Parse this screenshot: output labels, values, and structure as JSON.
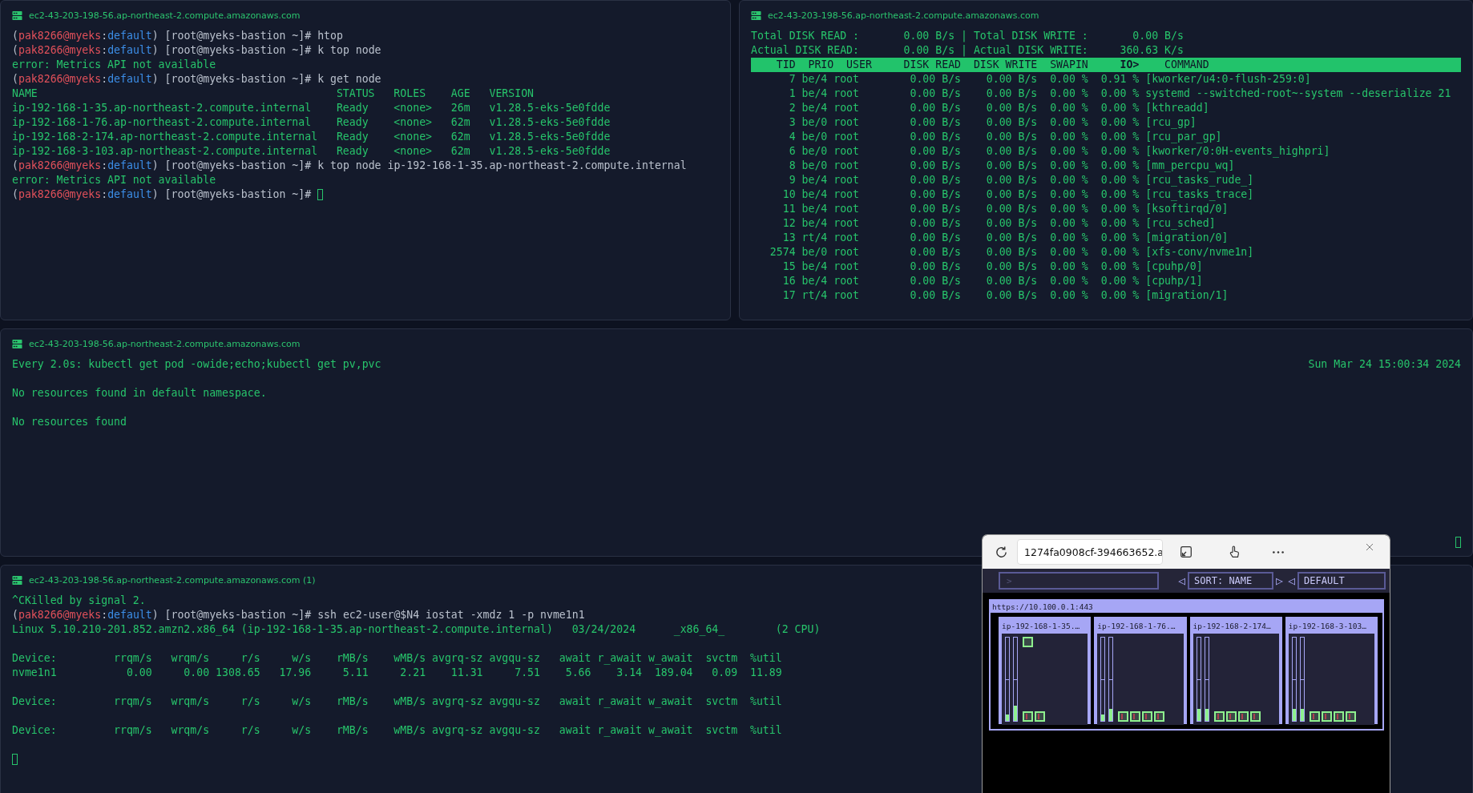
{
  "panes": [
    {
      "title": "ec2-43-203-198-56.ap-northeast-2.compute.amazonaws.com",
      "lines": [
        {
          "kind": "prompt",
          "cursor": false,
          "parts": [
            {
              "kind": "plain",
              "text": "("
            },
            {
              "kind": "user",
              "text": "pak8266@myeks"
            },
            {
              "kind": "plain",
              "text": ":"
            },
            {
              "kind": "context",
              "text": "default"
            },
            {
              "kind": "plain",
              "text": ") [root@myeks-bastion ~]# htop"
            }
          ]
        },
        {
          "kind": "prompt",
          "cursor": false,
          "parts": [
            {
              "kind": "plain",
              "text": "("
            },
            {
              "kind": "user",
              "text": "pak8266@myeks"
            },
            {
              "kind": "plain",
              "text": ":"
            },
            {
              "kind": "context",
              "text": "default"
            },
            {
              "kind": "plain",
              "text": ") [root@myeks-bastion ~]# k top node"
            }
          ]
        },
        {
          "kind": "output",
          "text": "error: Metrics API not available"
        },
        {
          "kind": "prompt",
          "cursor": false,
          "parts": [
            {
              "kind": "plain",
              "text": "("
            },
            {
              "kind": "user",
              "text": "pak8266@myeks"
            },
            {
              "kind": "plain",
              "text": ":"
            },
            {
              "kind": "context",
              "text": "default"
            },
            {
              "kind": "plain",
              "text": ") [root@myeks-bastion ~]# k get node"
            }
          ]
        },
        {
          "kind": "output",
          "text": "NAME                                               STATUS   ROLES    AGE   VERSION"
        },
        {
          "kind": "output",
          "text": "ip-192-168-1-35.ap-northeast-2.compute.internal    Ready    <none>   26m   v1.28.5-eks-5e0fdde"
        },
        {
          "kind": "output",
          "text": "ip-192-168-1-76.ap-northeast-2.compute.internal    Ready    <none>   62m   v1.28.5-eks-5e0fdde"
        },
        {
          "kind": "output",
          "text": "ip-192-168-2-174.ap-northeast-2.compute.internal   Ready    <none>   62m   v1.28.5-eks-5e0fdde"
        },
        {
          "kind": "output",
          "text": "ip-192-168-3-103.ap-northeast-2.compute.internal   Ready    <none>   62m   v1.28.5-eks-5e0fdde"
        },
        {
          "kind": "prompt",
          "cursor": false,
          "parts": [
            {
              "kind": "plain",
              "text": "("
            },
            {
              "kind": "user",
              "text": "pak8266@myeks"
            },
            {
              "kind": "plain",
              "text": ":"
            },
            {
              "kind": "context",
              "text": "default"
            },
            {
              "kind": "plain",
              "text": ") [root@myeks-bastion ~]# k top node ip-192-168-1-35.ap-northeast-2.compute.internal"
            }
          ]
        },
        {
          "kind": "output",
          "text": "error: Metrics API not available"
        },
        {
          "kind": "prompt",
          "cursor": true,
          "parts": [
            {
              "kind": "plain",
              "text": "("
            },
            {
              "kind": "user",
              "text": "pak8266@myeks"
            },
            {
              "kind": "plain",
              "text": ":"
            },
            {
              "kind": "context",
              "text": "default"
            },
            {
              "kind": "plain",
              "text": ") [root@myeks-bastion ~]#"
            }
          ]
        }
      ]
    },
    {
      "title": "ec2-43-203-198-56.ap-northeast-2.compute.amazonaws.com",
      "lines": [
        {
          "kind": "output",
          "text": "Total DISK READ :       0.00 B/s | Total DISK WRITE :       0.00 B/s"
        },
        {
          "kind": "output",
          "text": "Actual DISK READ:       0.00 B/s | Actual DISK WRITE:     360.63 K/s"
        },
        {
          "kind": "header",
          "text": "    TID  PRIO  USER     DISK READ  DISK WRITE  SWAPIN     **IO>**    COMMAND"
        },
        {
          "kind": "output",
          "text": "      7 be/4 root        0.00 B/s    0.00 B/s  0.00 %  0.91 % [kworker/u4:0-flush-259:0]"
        },
        {
          "kind": "output",
          "text": "      1 be/4 root        0.00 B/s    0.00 B/s  0.00 %  0.00 % systemd --switched-root~-system --deserialize 21"
        },
        {
          "kind": "output",
          "text": "      2 be/4 root        0.00 B/s    0.00 B/s  0.00 %  0.00 % [kthreadd]"
        },
        {
          "kind": "output",
          "text": "      3 be/0 root        0.00 B/s    0.00 B/s  0.00 %  0.00 % [rcu_gp]"
        },
        {
          "kind": "output",
          "text": "      4 be/0 root        0.00 B/s    0.00 B/s  0.00 %  0.00 % [rcu_par_gp]"
        },
        {
          "kind": "output",
          "text": "      6 be/0 root        0.00 B/s    0.00 B/s  0.00 %  0.00 % [kworker/0:0H-events_highpri]"
        },
        {
          "kind": "output",
          "text": "      8 be/0 root        0.00 B/s    0.00 B/s  0.00 %  0.00 % [mm_percpu_wq]"
        },
        {
          "kind": "output",
          "text": "      9 be/4 root        0.00 B/s    0.00 B/s  0.00 %  0.00 % [rcu_tasks_rude_]"
        },
        {
          "kind": "output",
          "text": "     10 be/4 root        0.00 B/s    0.00 B/s  0.00 %  0.00 % [rcu_tasks_trace]"
        },
        {
          "kind": "output",
          "text": "     11 be/4 root        0.00 B/s    0.00 B/s  0.00 %  0.00 % [ksoftirqd/0]"
        },
        {
          "kind": "output",
          "text": "     12 be/4 root        0.00 B/s    0.00 B/s  0.00 %  0.00 % [rcu_sched]"
        },
        {
          "kind": "output",
          "text": "     13 rt/4 root        0.00 B/s    0.00 B/s  0.00 %  0.00 % [migration/0]"
        },
        {
          "kind": "output",
          "text": "   2574 be/0 root        0.00 B/s    0.00 B/s  0.00 %  0.00 % [xfs-conv/nvme1n]"
        },
        {
          "kind": "output",
          "text": "     15 be/4 root        0.00 B/s    0.00 B/s  0.00 %  0.00 % [cpuhp/0]"
        },
        {
          "kind": "output",
          "text": "     16 be/4 root        0.00 B/s    0.00 B/s  0.00 %  0.00 % [cpuhp/1]"
        },
        {
          "kind": "output",
          "text": "     17 rt/4 root        0.00 B/s    0.00 B/s  0.00 %  0.00 % [migration/1]"
        }
      ]
    },
    {
      "title": "ec2-43-203-198-56.ap-northeast-2.compute.amazonaws.com",
      "lines": [
        {
          "kind": "watch",
          "text": "Every 2.0s: kubectl get pod -owide;echo;kubectl get pv,pvc",
          "time": "Sun Mar 24 15:00:34 2024"
        },
        {
          "kind": "blank"
        },
        {
          "kind": "output",
          "text": "No resources found in default namespace."
        },
        {
          "kind": "blank"
        },
        {
          "kind": "output",
          "text": "No resources found"
        },
        {
          "kind": "end_cursor"
        }
      ]
    },
    {
      "title": "ec2-43-203-198-56.ap-northeast-2.compute.amazonaws.com (1)",
      "lines": [
        {
          "kind": "output",
          "text": "^CKilled by signal 2."
        },
        {
          "kind": "prompt",
          "cursor": false,
          "parts": [
            {
              "kind": "plain",
              "text": "("
            },
            {
              "kind": "user",
              "text": "pak8266@myeks"
            },
            {
              "kind": "plain",
              "text": ":"
            },
            {
              "kind": "context",
              "text": "default"
            },
            {
              "kind": "plain",
              "text": ") [root@myeks-bastion ~]# ssh ec2-user@$N4 iostat -xmdz 1 -p nvme1n1"
            }
          ]
        },
        {
          "kind": "output",
          "text": "Linux 5.10.210-201.852.amzn2.x86_64 (ip-192-168-1-35.ap-northeast-2.compute.internal)   03/24/2024      _x86_64_        (2 CPU)"
        },
        {
          "kind": "blank"
        },
        {
          "kind": "output",
          "text": "Device:         rrqm/s   wrqm/s     r/s     w/s    rMB/s    wMB/s avgrq-sz avgqu-sz   await r_await w_await  svctm  %util"
        },
        {
          "kind": "output",
          "text": "nvme1n1           0.00     0.00 1308.65   17.96     5.11     2.21    11.31     7.51    5.66    3.14  189.04   0.09  11.89"
        },
        {
          "kind": "blank"
        },
        {
          "kind": "output",
          "text": "Device:         rrqm/s   wrqm/s     r/s     w/s    rMB/s    wMB/s avgrq-sz avgqu-sz   await r_await w_await  svctm  %util"
        },
        {
          "kind": "blank"
        },
        {
          "kind": "output",
          "text": "Device:         rrqm/s   wrqm/s     r/s     w/s    rMB/s    wMB/s avgrq-sz avgqu-sz   await r_await w_await  svctm  %util"
        },
        {
          "kind": "blank"
        },
        {
          "kind": "cursor"
        }
      ]
    }
  ],
  "viewer": {
    "address": "1274fa0908cf-394663652.a",
    "filter": {
      "placeholder": ">"
    },
    "sort_prev": "◁",
    "sort": "SORT: NAME",
    "sort_next": "▷",
    "view_prev": "◁",
    "view": "DEFAULT",
    "cluster": {
      "url": "https://10.100.0.1:443",
      "nodes": [
        {
          "name": "ip-192-168-1-35.…",
          "bars": [
            {
              "level": 0.08
            },
            {
              "level": 0.18
            }
          ],
          "pods": [
            {
              "kind": "pending"
            },
            {
              "kind": "running"
            },
            {
              "kind": "running"
            }
          ]
        },
        {
          "name": "ip-192-168-1-76.…",
          "bars": [
            {
              "level": 0.08
            },
            {
              "level": 0.14
            }
          ],
          "pods": [
            {
              "kind": "running"
            },
            {
              "kind": "running"
            },
            {
              "kind": "running"
            },
            {
              "kind": "running"
            }
          ]
        },
        {
          "name": "ip-192-168-2-174…",
          "bars": [
            {
              "level": 0.14
            },
            {
              "level": 0.14
            }
          ],
          "pods": [
            {
              "kind": "running"
            },
            {
              "kind": "running"
            },
            {
              "kind": "running"
            },
            {
              "kind": "running"
            }
          ]
        },
        {
          "name": "ip-192-168-3-103…",
          "bars": [
            {
              "level": 0.14
            },
            {
              "level": 0.14
            }
          ],
          "pods": [
            {
              "kind": "running"
            },
            {
              "kind": "running"
            },
            {
              "kind": "running"
            },
            {
              "kind": "running"
            }
          ]
        }
      ]
    }
  }
}
